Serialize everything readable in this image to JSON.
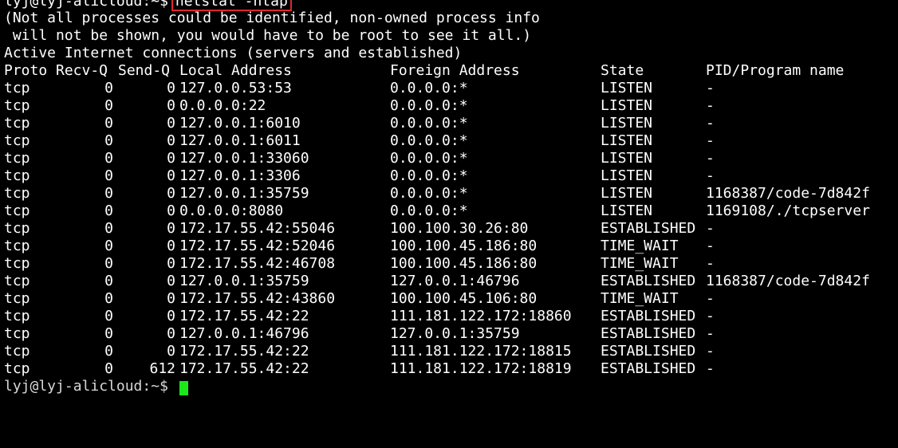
{
  "prompt": {
    "user_host": "lyj@lyj-alicloud:~$",
    "command": "netstat -ntap"
  },
  "messages": [
    "(Not all processes could be identified, non-owned process info",
    " will not be shown, you would have to be root to see it all.)",
    "Active Internet connections (servers and established)"
  ],
  "headers": {
    "proto": "Proto",
    "recv": "Recv-Q",
    "send": "Send-Q",
    "local": "Local Address",
    "foreign": "Foreign Address",
    "state": "State",
    "pid": "PID/Program name"
  },
  "rows": [
    {
      "proto": "tcp",
      "recv": "0",
      "send": "0",
      "local": "127.0.0.53:53",
      "foreign": "0.0.0.0:*",
      "state": "LISTEN",
      "pid": "-"
    },
    {
      "proto": "tcp",
      "recv": "0",
      "send": "0",
      "local": "0.0.0.0:22",
      "foreign": "0.0.0.0:*",
      "state": "LISTEN",
      "pid": "-"
    },
    {
      "proto": "tcp",
      "recv": "0",
      "send": "0",
      "local": "127.0.0.1:6010",
      "foreign": "0.0.0.0:*",
      "state": "LISTEN",
      "pid": "-"
    },
    {
      "proto": "tcp",
      "recv": "0",
      "send": "0",
      "local": "127.0.0.1:6011",
      "foreign": "0.0.0.0:*",
      "state": "LISTEN",
      "pid": "-"
    },
    {
      "proto": "tcp",
      "recv": "0",
      "send": "0",
      "local": "127.0.0.1:33060",
      "foreign": "0.0.0.0:*",
      "state": "LISTEN",
      "pid": "-"
    },
    {
      "proto": "tcp",
      "recv": "0",
      "send": "0",
      "local": "127.0.0.1:3306",
      "foreign": "0.0.0.0:*",
      "state": "LISTEN",
      "pid": "-"
    },
    {
      "proto": "tcp",
      "recv": "0",
      "send": "0",
      "local": "127.0.0.1:35759",
      "foreign": "0.0.0.0:*",
      "state": "LISTEN",
      "pid": "1168387/code-7d842f"
    },
    {
      "proto": "tcp",
      "recv": "0",
      "send": "0",
      "local": "0.0.0.0:8080",
      "foreign": "0.0.0.0:*",
      "state": "LISTEN",
      "pid": "1169108/./tcpserver"
    },
    {
      "proto": "tcp",
      "recv": "0",
      "send": "0",
      "local": "172.17.55.42:55046",
      "foreign": "100.100.30.26:80",
      "state": "ESTABLISHED",
      "pid": "-"
    },
    {
      "proto": "tcp",
      "recv": "0",
      "send": "0",
      "local": "172.17.55.42:52046",
      "foreign": "100.100.45.186:80",
      "state": "TIME_WAIT",
      "pid": "-"
    },
    {
      "proto": "tcp",
      "recv": "0",
      "send": "0",
      "local": "172.17.55.42:46708",
      "foreign": "100.100.45.186:80",
      "state": "TIME_WAIT",
      "pid": "-"
    },
    {
      "proto": "tcp",
      "recv": "0",
      "send": "0",
      "local": "127.0.0.1:35759",
      "foreign": "127.0.0.1:46796",
      "state": "ESTABLISHED",
      "pid": "1168387/code-7d842f"
    },
    {
      "proto": "tcp",
      "recv": "0",
      "send": "0",
      "local": "172.17.55.42:43860",
      "foreign": "100.100.45.106:80",
      "state": "TIME_WAIT",
      "pid": "-"
    },
    {
      "proto": "tcp",
      "recv": "0",
      "send": "0",
      "local": "172.17.55.42:22",
      "foreign": "111.181.122.172:18860",
      "state": "ESTABLISHED",
      "pid": "-"
    },
    {
      "proto": "tcp",
      "recv": "0",
      "send": "0",
      "local": "127.0.0.1:46796",
      "foreign": "127.0.0.1:35759",
      "state": "ESTABLISHED",
      "pid": "-"
    },
    {
      "proto": "tcp",
      "recv": "0",
      "send": "0",
      "local": "172.17.55.42:22",
      "foreign": "111.181.122.172:18815",
      "state": "ESTABLISHED",
      "pid": "-"
    },
    {
      "proto": "tcp",
      "recv": "0",
      "send": "612",
      "local": "172.17.55.42:22",
      "foreign": "111.181.122.172:18819",
      "state": "ESTABLISHED",
      "pid": "-"
    }
  ],
  "colors": {
    "background": "#000000",
    "text": "#ffffff",
    "highlight_box": "#e0262b",
    "cursor": "#1ae81a"
  }
}
